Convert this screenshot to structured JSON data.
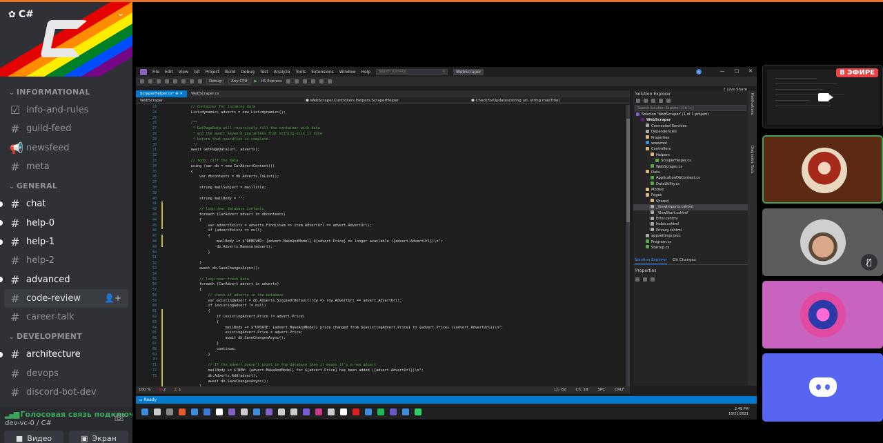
{
  "server": {
    "name": "C#",
    "stripe_colors": [
      "#e40303",
      "#ff8c00",
      "#ffed00",
      "#008026",
      "#004dff",
      "#750787"
    ]
  },
  "categories": [
    {
      "name": "INFORMATIONAL",
      "channels": [
        {
          "name": "info-and-rules",
          "icon": "rules-icon",
          "unread": false
        },
        {
          "name": "guild-feed",
          "icon": "hash-icon",
          "unread": false
        },
        {
          "name": "newsfeed",
          "icon": "announcement-icon",
          "unread": false
        },
        {
          "name": "meta",
          "icon": "hash-icon",
          "unread": false
        }
      ]
    },
    {
      "name": "GENERAL",
      "channels": [
        {
          "name": "chat",
          "unread": true
        },
        {
          "name": "help-0",
          "unread": true
        },
        {
          "name": "help-1",
          "unread": true
        },
        {
          "name": "help-2",
          "unread": false
        },
        {
          "name": "advanced",
          "unread": true
        },
        {
          "name": "code-review",
          "unread": false,
          "active": true
        },
        {
          "name": "career-talk",
          "unread": false
        }
      ]
    },
    {
      "name": "DEVELOPMENT",
      "channels": [
        {
          "name": "architecture",
          "unread": true
        },
        {
          "name": "devops",
          "unread": false
        },
        {
          "name": "discord-bot-dev",
          "unread": false
        }
      ]
    }
  ],
  "voice": {
    "status": "Голосовая связь подключ",
    "channel": "dev-vc-0 / C#",
    "video_label": "Видео",
    "screen_label": "Экран"
  },
  "vs": {
    "menu": [
      "File",
      "Edit",
      "View",
      "Git",
      "Project",
      "Build",
      "Debug",
      "Test",
      "Analyze",
      "Tools",
      "Extensions",
      "Window",
      "Help"
    ],
    "search_placeholder": "Search (Ctrl+Q)",
    "solution_name": "WebScraper",
    "user_initials": "AJ",
    "config": "Debug",
    "platform": "Any CPU",
    "run_target": "IIS Express",
    "live_share": "Live Share",
    "tabs": [
      "ScraperHelper.cs*",
      "WebScraper.cs"
    ],
    "nav": [
      "WebScraper",
      "WebScraper.Controllers.Helpers.ScraperHelper",
      "CheckForUpdates(string url, string mailTitle)"
    ],
    "line_numbers": [
      "23",
      "24",
      "25",
      "26",
      "27",
      "28",
      "29",
      "30",
      "31",
      "32",
      "33",
      "34",
      "35",
      "36",
      "37",
      "38",
      "39",
      "40",
      "41",
      "42",
      "43",
      "44",
      "45",
      "46",
      "47",
      "48",
      "49",
      "50",
      "51",
      "52",
      "53",
      "54",
      "55",
      "56",
      "57",
      "58",
      "59",
      "60",
      "61",
      "62",
      "63",
      "64",
      "65",
      "66",
      "67",
      "68",
      "69",
      "70",
      "71",
      "72",
      "73"
    ],
    "code_lines": [
      {
        "t": "            // Container for incoming data",
        "c": "comment"
      },
      {
        "t": "            List<dynamic> adverts = new List<dynamic>();",
        "c": ""
      },
      {
        "t": "",
        "c": ""
      },
      {
        "t": "            /**",
        "c": "comment"
      },
      {
        "t": "             * GetPageData will recursively fill the container with data",
        "c": "comment"
      },
      {
        "t": "             * and the await keyword guarantees that nothing else is done",
        "c": "comment"
      },
      {
        "t": "             * before that operation is complete.",
        "c": "comment"
      },
      {
        "t": "             */",
        "c": "comment"
      },
      {
        "t": "            await GetPageData(url, adverts);",
        "c": ""
      },
      {
        "t": "",
        "c": ""
      },
      {
        "t": "            // todo: diff the data",
        "c": "comment"
      },
      {
        "t": "            using (var db = new CarAdvertContext())",
        "c": ""
      },
      {
        "t": "            {",
        "c": ""
      },
      {
        "t": "                var dbcontents = db.Adverts.ToList();",
        "c": ""
      },
      {
        "t": "",
        "c": ""
      },
      {
        "t": "                string mailSubject = mailTitle;",
        "c": ""
      },
      {
        "t": "",
        "c": ""
      },
      {
        "t": "                string mailBody = \"\";",
        "c": ""
      },
      {
        "t": "",
        "c": ""
      },
      {
        "t": "                // loop over database contents",
        "c": "comment"
      },
      {
        "t": "                foreach (CarAdvert advert in dbcontents)",
        "c": ""
      },
      {
        "t": "                {",
        "c": ""
      },
      {
        "t": "                    var advertExists = adverts.Find(item => item.AdvertUrl == advert.AdvertUrl);",
        "c": ""
      },
      {
        "t": "                    if (advertExists == null)",
        "c": ""
      },
      {
        "t": "                    {",
        "c": ""
      },
      {
        "t": "                        mailBody += $\"REMOVED: {advert.MakeAndModel} ${advert.Price} no longer available ({advert.AdvertUrl})\\n\";",
        "c": ""
      },
      {
        "t": "                        db.Adverts.Remove(advert);",
        "c": ""
      },
      {
        "t": "                    }",
        "c": ""
      },
      {
        "t": "",
        "c": ""
      },
      {
        "t": "                }",
        "c": ""
      },
      {
        "t": "                await db.SaveChangesAsync();",
        "c": ""
      },
      {
        "t": "",
        "c": ""
      },
      {
        "t": "                // loop over fresh data",
        "c": "comment"
      },
      {
        "t": "                foreach (CarAdvert advert in adverts)",
        "c": ""
      },
      {
        "t": "                {",
        "c": ""
      },
      {
        "t": "                    // check if adverts in the database",
        "c": "comment"
      },
      {
        "t": "                    var existingAdvert = db.Adverts.SingleOrDefault(row => row.AdvertUrl == advert.AdvertUrl);",
        "c": ""
      },
      {
        "t": "                    if (existingAdvert != null)",
        "c": ""
      },
      {
        "t": "                    {",
        "c": ""
      },
      {
        "t": "                        if (existingAdvert.Price != advert.Price)",
        "c": ""
      },
      {
        "t": "                        {",
        "c": ""
      },
      {
        "t": "                            mailBody += $\"UPDATE: {advert.MakeAndModel} price changed from ${existingAdvert.Price} to {advert.Price} ({advert.AdvertUrl})\\n\";",
        "c": ""
      },
      {
        "t": "                            existingAdvert.Price = advert.Price;",
        "c": ""
      },
      {
        "t": "                            await db.SaveChangesAsync();",
        "c": ""
      },
      {
        "t": "                        }",
        "c": ""
      },
      {
        "t": "                        continue;",
        "c": ""
      },
      {
        "t": "                    }",
        "c": ""
      },
      {
        "t": "",
        "c": ""
      },
      {
        "t": "                    // If the advert doesn't exist in the database then it means it's a new advert",
        "c": "comment"
      },
      {
        "t": "                    mailBody += $\"NEW: {advert.MakeAndModel} for ${advert.Price} has been added ({advert.AdvertUrl})\\n\";",
        "c": ""
      },
      {
        "t": "                    db.Adverts.Add(advert);",
        "c": ""
      },
      {
        "t": "                    await db.SaveChangesAsync();",
        "c": ""
      },
      {
        "t": "                }",
        "c": ""
      }
    ],
    "status_zoom": "100 %",
    "status_errors": "2",
    "status_warnings": "1",
    "status_ln": "Ln: 82",
    "status_ch": "Ch: 18",
    "status_spc": "SPC",
    "status_crlf": "CRLF",
    "ready": "Ready",
    "clock_time": "2:49 PM",
    "clock_date": "10/21/2021",
    "solution_explorer_title": "Solution Explorer",
    "se_search": "Search Solution Explorer (Ctrl+;)",
    "tree": [
      {
        "label": "Solution 'WebScraper' (1 of 1 project)",
        "indent": 0,
        "color": "#8661c5"
      },
      {
        "label": "WebScraper",
        "indent": 1,
        "color": "#68217a",
        "bold": true
      },
      {
        "label": "Connected Services",
        "indent": 2,
        "color": "#aaaaaa"
      },
      {
        "label": "Dependencies",
        "indent": 2,
        "color": "#aaaaaa"
      },
      {
        "label": "Properties",
        "indent": 2,
        "color": "#dcb67a"
      },
      {
        "label": "wwwroot",
        "indent": 2,
        "color": "#3c8dde"
      },
      {
        "label": "Controllers",
        "indent": 2,
        "color": "#dcb67a"
      },
      {
        "label": "Helpers",
        "indent": 3,
        "color": "#dcb67a"
      },
      {
        "label": "ScraperHelper.cs",
        "indent": 4,
        "color": "#57a64a"
      },
      {
        "label": "WebScraper.cs",
        "indent": 3,
        "color": "#57a64a"
      },
      {
        "label": "Data",
        "indent": 2,
        "color": "#dcb67a"
      },
      {
        "label": "ApplicationDbContext.cs",
        "indent": 3,
        "color": "#57a64a"
      },
      {
        "label": "DataUtility.cs",
        "indent": 3,
        "color": "#57a64a"
      },
      {
        "label": "Models",
        "indent": 2,
        "color": "#dcb67a"
      },
      {
        "label": "Pages",
        "indent": 2,
        "color": "#dcb67a"
      },
      {
        "label": "Shared",
        "indent": 3,
        "color": "#dcb67a"
      },
      {
        "label": "_ViewImports.cshtml",
        "indent": 3,
        "color": "#aaaaaa",
        "sel": true
      },
      {
        "label": "_ViewStart.cshtml",
        "indent": 3,
        "color": "#aaaaaa"
      },
      {
        "label": "Error.cshtml",
        "indent": 3,
        "color": "#aaaaaa"
      },
      {
        "label": "Index.cshtml",
        "indent": 3,
        "color": "#aaaaaa"
      },
      {
        "label": "Privacy.cshtml",
        "indent": 3,
        "color": "#aaaaaa"
      },
      {
        "label": "appsettings.json",
        "indent": 2,
        "color": "#aaaaaa"
      },
      {
        "label": "Program.cs",
        "indent": 2,
        "color": "#57a64a"
      },
      {
        "label": "Startup.cs",
        "indent": 2,
        "color": "#57a64a"
      }
    ],
    "se_tab_1": "Solution Explorer",
    "se_tab_2": "Git Changes",
    "properties_title": "Properties",
    "side_labels": [
      "Notifications",
      "Diagnostic Tools"
    ]
  },
  "tiles": {
    "live_badge": "В ЭФИРЕ"
  }
}
